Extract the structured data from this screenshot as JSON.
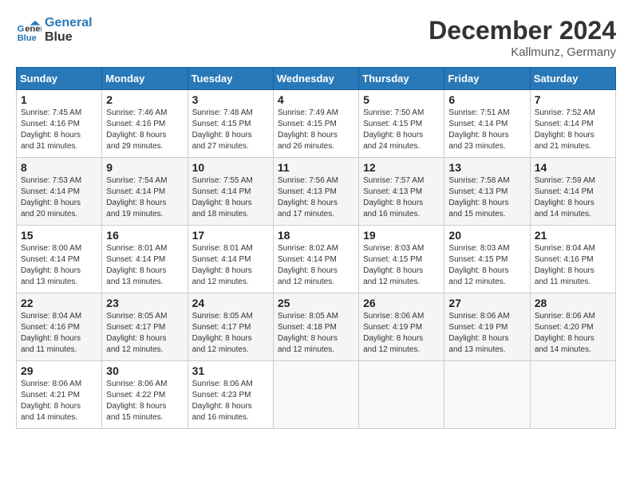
{
  "header": {
    "logo_line1": "General",
    "logo_line2": "Blue",
    "month_title": "December 2024",
    "location": "Kallmunz, Germany"
  },
  "days_of_week": [
    "Sunday",
    "Monday",
    "Tuesday",
    "Wednesday",
    "Thursday",
    "Friday",
    "Saturday"
  ],
  "weeks": [
    [
      {
        "day": "1",
        "info": "Sunrise: 7:45 AM\nSunset: 4:16 PM\nDaylight: 8 hours\nand 31 minutes."
      },
      {
        "day": "2",
        "info": "Sunrise: 7:46 AM\nSunset: 4:16 PM\nDaylight: 8 hours\nand 29 minutes."
      },
      {
        "day": "3",
        "info": "Sunrise: 7:48 AM\nSunset: 4:15 PM\nDaylight: 8 hours\nand 27 minutes."
      },
      {
        "day": "4",
        "info": "Sunrise: 7:49 AM\nSunset: 4:15 PM\nDaylight: 8 hours\nand 26 minutes."
      },
      {
        "day": "5",
        "info": "Sunrise: 7:50 AM\nSunset: 4:15 PM\nDaylight: 8 hours\nand 24 minutes."
      },
      {
        "day": "6",
        "info": "Sunrise: 7:51 AM\nSunset: 4:14 PM\nDaylight: 8 hours\nand 23 minutes."
      },
      {
        "day": "7",
        "info": "Sunrise: 7:52 AM\nSunset: 4:14 PM\nDaylight: 8 hours\nand 21 minutes."
      }
    ],
    [
      {
        "day": "8",
        "info": "Sunrise: 7:53 AM\nSunset: 4:14 PM\nDaylight: 8 hours\nand 20 minutes."
      },
      {
        "day": "9",
        "info": "Sunrise: 7:54 AM\nSunset: 4:14 PM\nDaylight: 8 hours\nand 19 minutes."
      },
      {
        "day": "10",
        "info": "Sunrise: 7:55 AM\nSunset: 4:14 PM\nDaylight: 8 hours\nand 18 minutes."
      },
      {
        "day": "11",
        "info": "Sunrise: 7:56 AM\nSunset: 4:13 PM\nDaylight: 8 hours\nand 17 minutes."
      },
      {
        "day": "12",
        "info": "Sunrise: 7:57 AM\nSunset: 4:13 PM\nDaylight: 8 hours\nand 16 minutes."
      },
      {
        "day": "13",
        "info": "Sunrise: 7:58 AM\nSunset: 4:13 PM\nDaylight: 8 hours\nand 15 minutes."
      },
      {
        "day": "14",
        "info": "Sunrise: 7:59 AM\nSunset: 4:14 PM\nDaylight: 8 hours\nand 14 minutes."
      }
    ],
    [
      {
        "day": "15",
        "info": "Sunrise: 8:00 AM\nSunset: 4:14 PM\nDaylight: 8 hours\nand 13 minutes."
      },
      {
        "day": "16",
        "info": "Sunrise: 8:01 AM\nSunset: 4:14 PM\nDaylight: 8 hours\nand 13 minutes."
      },
      {
        "day": "17",
        "info": "Sunrise: 8:01 AM\nSunset: 4:14 PM\nDaylight: 8 hours\nand 12 minutes."
      },
      {
        "day": "18",
        "info": "Sunrise: 8:02 AM\nSunset: 4:14 PM\nDaylight: 8 hours\nand 12 minutes."
      },
      {
        "day": "19",
        "info": "Sunrise: 8:03 AM\nSunset: 4:15 PM\nDaylight: 8 hours\nand 12 minutes."
      },
      {
        "day": "20",
        "info": "Sunrise: 8:03 AM\nSunset: 4:15 PM\nDaylight: 8 hours\nand 12 minutes."
      },
      {
        "day": "21",
        "info": "Sunrise: 8:04 AM\nSunset: 4:16 PM\nDaylight: 8 hours\nand 11 minutes."
      }
    ],
    [
      {
        "day": "22",
        "info": "Sunrise: 8:04 AM\nSunset: 4:16 PM\nDaylight: 8 hours\nand 11 minutes."
      },
      {
        "day": "23",
        "info": "Sunrise: 8:05 AM\nSunset: 4:17 PM\nDaylight: 8 hours\nand 12 minutes."
      },
      {
        "day": "24",
        "info": "Sunrise: 8:05 AM\nSunset: 4:17 PM\nDaylight: 8 hours\nand 12 minutes."
      },
      {
        "day": "25",
        "info": "Sunrise: 8:05 AM\nSunset: 4:18 PM\nDaylight: 8 hours\nand 12 minutes."
      },
      {
        "day": "26",
        "info": "Sunrise: 8:06 AM\nSunset: 4:19 PM\nDaylight: 8 hours\nand 12 minutes."
      },
      {
        "day": "27",
        "info": "Sunrise: 8:06 AM\nSunset: 4:19 PM\nDaylight: 8 hours\nand 13 minutes."
      },
      {
        "day": "28",
        "info": "Sunrise: 8:06 AM\nSunset: 4:20 PM\nDaylight: 8 hours\nand 14 minutes."
      }
    ],
    [
      {
        "day": "29",
        "info": "Sunrise: 8:06 AM\nSunset: 4:21 PM\nDaylight: 8 hours\nand 14 minutes."
      },
      {
        "day": "30",
        "info": "Sunrise: 8:06 AM\nSunset: 4:22 PM\nDaylight: 8 hours\nand 15 minutes."
      },
      {
        "day": "31",
        "info": "Sunrise: 8:06 AM\nSunset: 4:23 PM\nDaylight: 8 hours\nand 16 minutes."
      },
      {
        "day": "",
        "info": ""
      },
      {
        "day": "",
        "info": ""
      },
      {
        "day": "",
        "info": ""
      },
      {
        "day": "",
        "info": ""
      }
    ]
  ]
}
